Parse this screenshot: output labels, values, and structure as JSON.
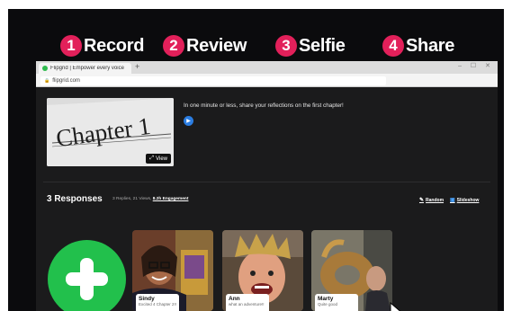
{
  "steps": [
    {
      "num": "1",
      "label": "Record"
    },
    {
      "num": "2",
      "label": "Review"
    },
    {
      "num": "3",
      "label": "Selfie"
    },
    {
      "num": "4",
      "label": "Share"
    }
  ],
  "browser": {
    "tab_title": "Flipgrid | Empower every voice",
    "new_tab": "+",
    "window_controls": "– ☐ ✕",
    "url": "flipgrid.com"
  },
  "topic": {
    "thumbnail_text": "Chapter 1",
    "view_label": "View",
    "prompt": "In one minute or less, share your reflections on the first chapter!"
  },
  "responses": {
    "title": "3 Responses",
    "meta_prefix": "3 Replies, 21 Views,",
    "engagement": "8.2h Engagement",
    "random_label": "Random",
    "slideshow_label": "Slideshow",
    "cards": [
      {
        "name": "Sindy",
        "caption": "Excited 4 Chapter 2!!"
      },
      {
        "name": "Ann",
        "caption": "what an adventure!!"
      },
      {
        "name": "Marty",
        "caption": "Quite good"
      }
    ]
  },
  "colors": {
    "step_badge": "#e2205a",
    "add_button": "#22c04c",
    "prompt_icon": "#2b7de1"
  }
}
